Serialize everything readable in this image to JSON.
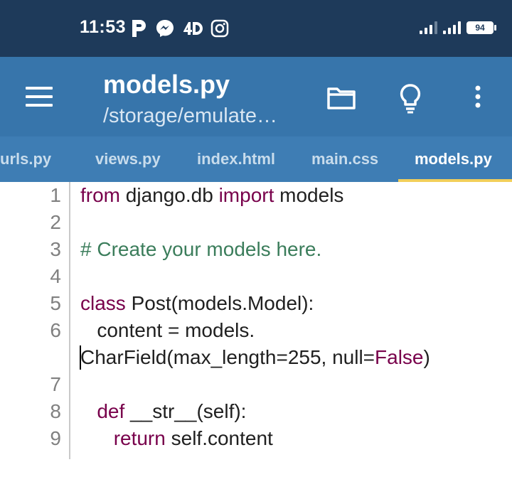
{
  "status_bar": {
    "time": "11:53",
    "notification_icons": [
      "p-app-icon",
      "messenger-icon",
      "4d-app-icon",
      "instagram-icon"
    ],
    "battery_level": "94"
  },
  "app_bar": {
    "title": "models.py",
    "subtitle": "/storage/emulate…",
    "actions": [
      "folder-icon",
      "lightbulb-icon",
      "more-vert-icon"
    ]
  },
  "tabs": [
    {
      "label": "urls.py",
      "active": false
    },
    {
      "label": "views.py",
      "active": false
    },
    {
      "label": "index.html",
      "active": false
    },
    {
      "label": "main.css",
      "active": false
    },
    {
      "label": "models.py",
      "active": true
    }
  ],
  "editor": {
    "lines": [
      {
        "number": "1",
        "segments": [
          {
            "text": "from",
            "type": "keyword"
          },
          {
            "text": " django.db ",
            "type": "plain"
          },
          {
            "text": "import",
            "type": "keyword"
          },
          {
            "text": " models",
            "type": "plain"
          }
        ]
      },
      {
        "number": "2",
        "segments": []
      },
      {
        "number": "3",
        "segments": [
          {
            "text": "# Create your models here.",
            "type": "comment"
          }
        ]
      },
      {
        "number": "4",
        "segments": []
      },
      {
        "number": "5",
        "segments": [
          {
            "text": "class",
            "type": "keyword"
          },
          {
            "text": " Post(models.Model):",
            "type": "plain"
          }
        ]
      },
      {
        "number": "6",
        "segments": [
          {
            "text": "   content = models.",
            "type": "plain"
          }
        ]
      },
      {
        "number": "",
        "segments": [
          {
            "text": "CharField(max_length=255, null=",
            "type": "plain"
          },
          {
            "text": "False",
            "type": "keyword"
          },
          {
            "text": ")",
            "type": "plain"
          }
        ]
      },
      {
        "number": "7",
        "segments": []
      },
      {
        "number": "8",
        "segments": [
          {
            "text": "   ",
            "type": "plain"
          },
          {
            "text": "def",
            "type": "keyword"
          },
          {
            "text": " __str__(self):",
            "type": "plain"
          }
        ]
      },
      {
        "number": "9",
        "segments": [
          {
            "text": "      ",
            "type": "plain"
          },
          {
            "text": "return",
            "type": "keyword"
          },
          {
            "text": " self.content",
            "type": "plain"
          }
        ]
      }
    ]
  },
  "colors": {
    "status_bar": "#1e3a5a",
    "app_bar": "#3775ab",
    "tab_bar": "#3e7db4",
    "tab_indicator": "#f2cf5a",
    "keyword": "#78004b",
    "comment": "#3b7d5b"
  }
}
